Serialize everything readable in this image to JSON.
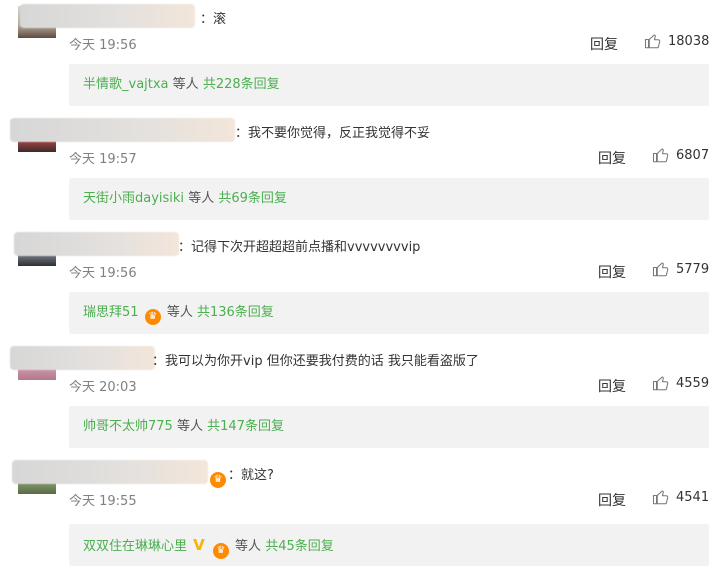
{
  "comments": [
    {
      "text": "滚",
      "time": "今天 19:56",
      "reply": "回复",
      "likes": "18038",
      "sub": {
        "user": "半情歌_vajtxa",
        "etc": "等人",
        "count": "共228条回复",
        "badges": []
      }
    },
    {
      "text": "我不要你觉得，反正我觉得不妥",
      "time": "今天 19:57",
      "reply": "回复",
      "likes": "6807",
      "sub": {
        "user": "天街小雨dayisiki",
        "etc": "等人",
        "count": "共69条回复",
        "badges": []
      }
    },
    {
      "text": "记得下次开超超超前点播和vvvvvvvvip",
      "time": "今天 19:56",
      "reply": "回复",
      "likes": "5779",
      "sub": {
        "user": "瑞思拜51",
        "etc": "等人",
        "count": "共136条回复",
        "badges": [
          "fan-badge"
        ]
      }
    },
    {
      "text": "我可以为你开vip 但你还要我付费的话 我只能看盗版了",
      "time": "今天 20:03",
      "reply": "回复",
      "likes": "4559",
      "sub": {
        "user": "帅哥不太帅775",
        "etc": "等人",
        "count": "共147条回复",
        "badges": []
      }
    },
    {
      "text": "就这?",
      "time": "今天 19:55",
      "reply": "回复",
      "likes": "4541",
      "sub": {
        "user": "双双住在琳琳心里",
        "etc": "等人",
        "count": "共45条回复",
        "badges": [
          "v-badge",
          "fan-badge"
        ]
      }
    }
  ],
  "colors": {
    "accent_green": "#4caf50",
    "sub_bg": "#f2f2f2",
    "time_gray": "#808080"
  },
  "icons": {
    "like": "thumbs-up-icon",
    "badge": "fan-badge-icon",
    "v": "verified-v-icon"
  }
}
